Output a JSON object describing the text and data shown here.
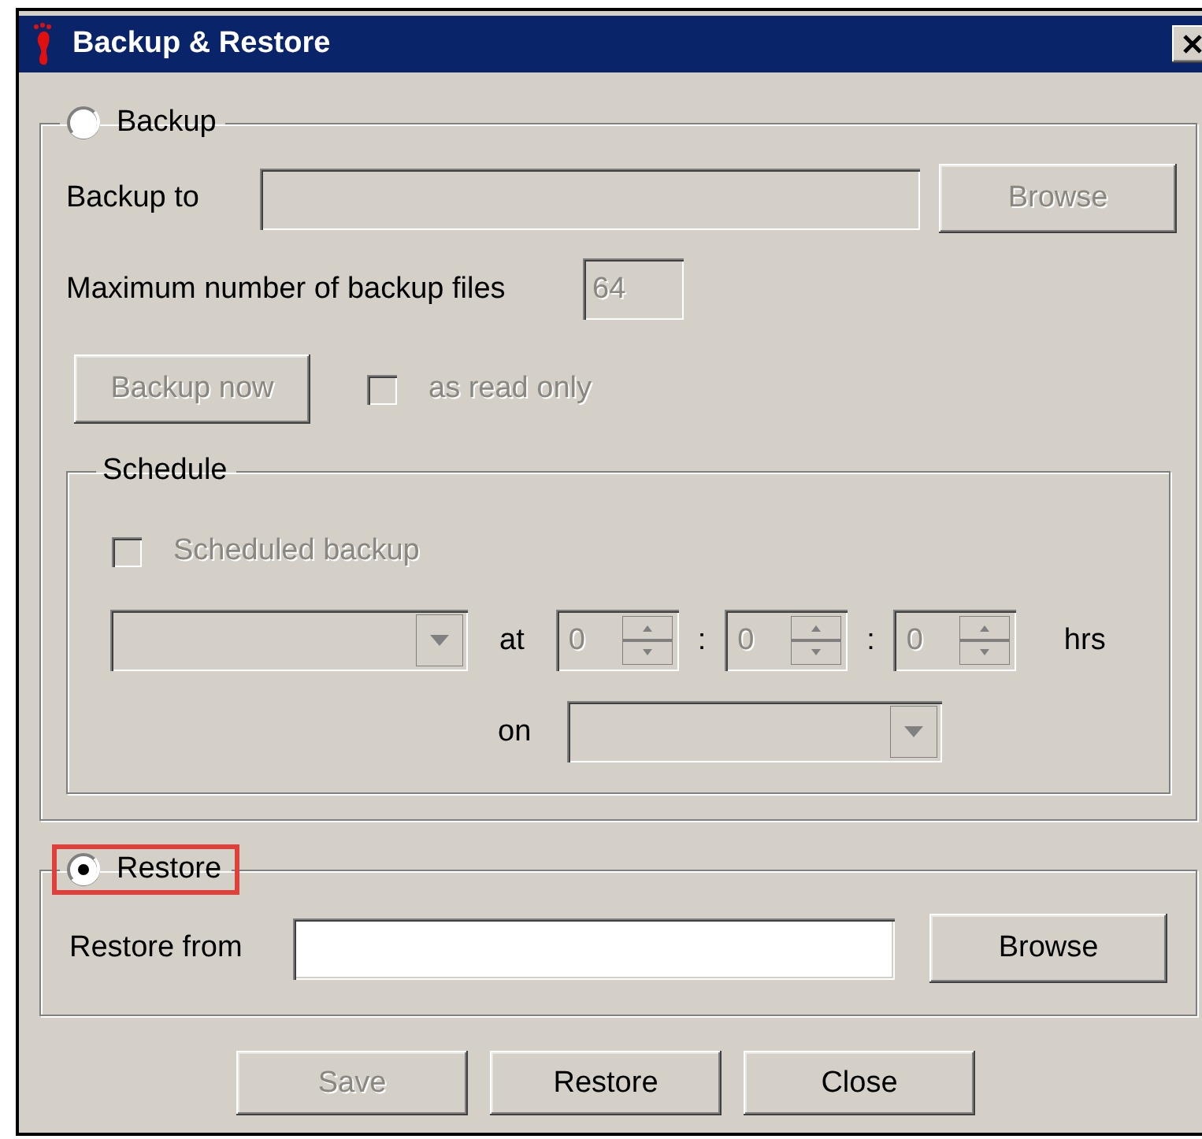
{
  "window": {
    "title": "Backup & Restore"
  },
  "backup": {
    "radio": {
      "label": "Backup",
      "selected": false
    },
    "destination": {
      "label": "Backup to",
      "disabled": true
    },
    "browse_button": {
      "label": "Browse",
      "disabled": true
    },
    "max_files": {
      "label": "Maximum number of backup files",
      "value": "64",
      "disabled": true
    },
    "backup_now_button": {
      "label": "Backup now",
      "disabled": true
    },
    "read_only": {
      "label": "as read only",
      "checked": false,
      "disabled": true
    },
    "schedule": {
      "title": "Schedule",
      "scheduled_backup": {
        "label": "Scheduled backup",
        "checked": false,
        "disabled": true
      },
      "frequency": {
        "disabled": true
      },
      "at_label": "at",
      "time": [
        {
          "value": "0",
          "disabled": true
        },
        {
          "value": "0",
          "disabled": true
        },
        {
          "value": "0",
          "disabled": true
        }
      ],
      "separators": [
        ":",
        ":"
      ],
      "hrs_label": "hrs",
      "on_label": "on",
      "day": {
        "disabled": true
      }
    }
  },
  "restore": {
    "radio": {
      "label": "Restore",
      "selected": true,
      "highlighted": true
    },
    "source": {
      "label": "Restore from",
      "disabled": false
    },
    "browse_button": {
      "label": "Browse",
      "disabled": false
    }
  },
  "buttons": [
    {
      "label": "Save",
      "disabled": true
    },
    {
      "label": "Restore",
      "disabled": false
    },
    {
      "label": "Close",
      "disabled": false
    }
  ]
}
